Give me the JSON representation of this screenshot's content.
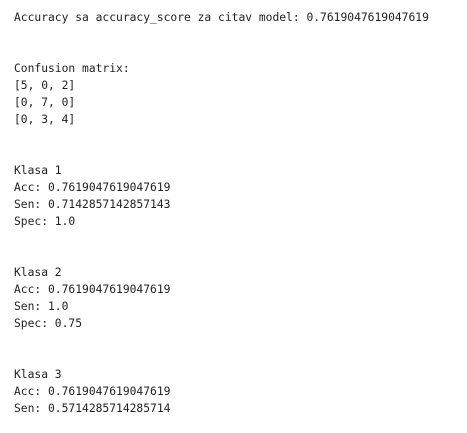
{
  "output": {
    "accuracy_line": "Accuracy sa accuracy_score za citav model: 0.7619047619047619",
    "confusion_title": "Confusion matrix:",
    "confusion_rows": [
      "[5, 0, 2]",
      "[0, 7, 0]",
      "[0, 3, 4]"
    ],
    "classes": [
      {
        "title": "Klasa 1",
        "acc": "Acc: 0.7619047619047619",
        "sen": "Sen: 0.7142857142857143",
        "spec": "Spec: 1.0"
      },
      {
        "title": "Klasa 2",
        "acc": "Acc: 0.7619047619047619",
        "sen": "Sen: 1.0",
        "spec": "Spec: 0.75"
      },
      {
        "title": "Klasa 3",
        "acc": "Acc: 0.7619047619047619",
        "sen": "Sen: 0.5714285714285714"
      }
    ]
  }
}
